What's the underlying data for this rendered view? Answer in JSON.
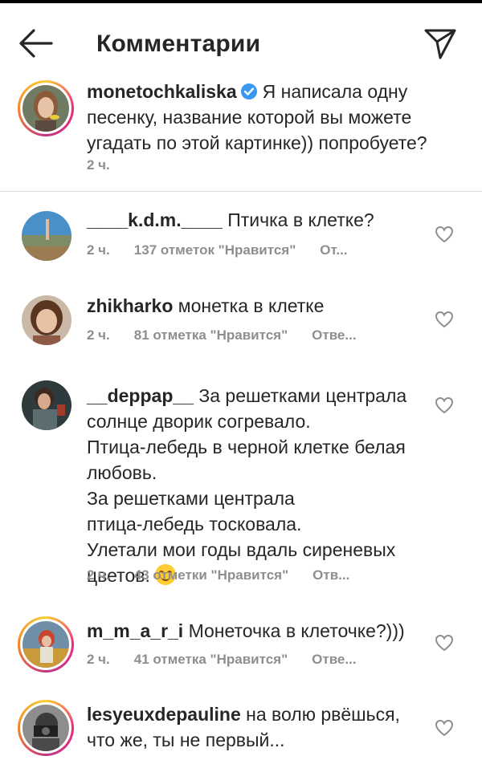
{
  "header": {
    "title": "Комментарии",
    "back_icon": "arrow-left-icon",
    "send_icon": "paper-plane-icon"
  },
  "caption": {
    "username": "monetochkaliska",
    "verified": true,
    "text": "Я написала одну\nпесенку, название которой вы можете\nугадать по этой картинке)) попробуете?",
    "time": "2 ч."
  },
  "comments": [
    {
      "username": "____k.d.m.____",
      "text": "Птичка в клетке?",
      "time": "2 ч.",
      "likes": "137 отметок \"Нравится\"",
      "reply": "От..."
    },
    {
      "username": "zhikharko",
      "text": "монетка в клетке",
      "time": "2 ч.",
      "likes": "81 отметка \"Нравится\"",
      "reply": "Отве..."
    },
    {
      "username": "__deppap__",
      "text": "За решетками централа\nсолнце дворик согревало.\nПтица-лебедь в черной клетке белая\nлюбовь.\nЗа решетками централа\nптица-лебедь тосковала.\nУлетали мои годы вдаль сиреневых\nцветов.",
      "time": "2 ч.",
      "likes": "43 отметки \"Нравится\"",
      "reply": "Отв..."
    },
    {
      "username": "m_m_a_r_i",
      "text": "Монеточка в клеточке?)))",
      "time": "2 ч.",
      "likes": "41 отметка \"Нравится\"",
      "reply": "Отве..."
    },
    {
      "username": "lesyeuxdepauline",
      "text": "на волю рвёшься,\nчто же, ты не первый...",
      "time": "",
      "likes": "",
      "reply": ""
    }
  ],
  "colors": {
    "text": "#262626",
    "meta": "#8e8e8e",
    "divider": "#dbdbdb",
    "verified": "#3897f0"
  }
}
